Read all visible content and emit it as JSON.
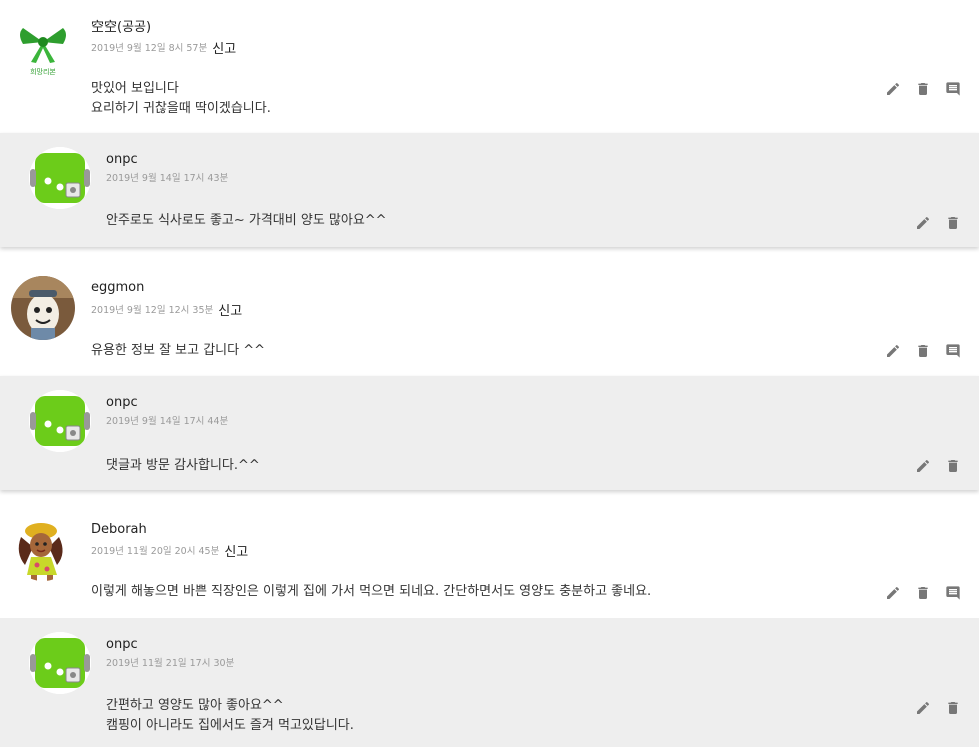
{
  "report_label": "신고",
  "threads": [
    {
      "comment": {
        "author": "空空(공공)",
        "date": "2019년 9월 12일 8시 57분",
        "text": "맛있어 보입니다\n요리하기 귀찮을때 딱이겠습니다.",
        "avatar": "green-ribbon-avatar",
        "avatar_caption": "희망리본"
      },
      "reply": {
        "author": "onpc",
        "date": "2019년 9월 14일 17시 43분",
        "text": "안주로도 식사로도 좋고~ 가격대비 양도 많아요^^",
        "avatar": "green-robot-avatar"
      }
    },
    {
      "comment": {
        "author": "eggmon",
        "date": "2019년 9월 12일 12시 35분",
        "text": "유용한 정보 잘 보고 갑니다 ^^",
        "avatar": "egg-character-avatar"
      },
      "reply": {
        "author": "onpc",
        "date": "2019년 9월 14일 17시 44분",
        "text": "댓글과 방문 감사합니다.^^",
        "avatar": "green-robot-avatar"
      }
    },
    {
      "comment": {
        "author": "Deborah",
        "date": "2019년 11월 20일 20시 45분",
        "text": "이렇게 해놓으면 바쁜 직장인은 이렇게 집에 가서 먹으면 되네요. 간단하면서도 영양도 충분하고 좋네요.",
        "avatar": "cartoon-girl-avatar"
      },
      "reply": {
        "author": "onpc",
        "date": "2019년 11월 21일 17시 30분",
        "text": "간편하고 영양도 많아 좋아요^^\n캠핑이 아니라도 집에서도 즐겨 먹고있답니다.",
        "avatar": "green-robot-avatar"
      }
    }
  ],
  "icons": {
    "edit": "pencil-icon",
    "delete": "trash-icon",
    "reply": "reply-bubble-icon"
  },
  "colors": {
    "icon": "#777777",
    "reply_bg": "#eeeeee",
    "meta": "#9a9a9a",
    "robot_green": "#6ccc1a"
  }
}
